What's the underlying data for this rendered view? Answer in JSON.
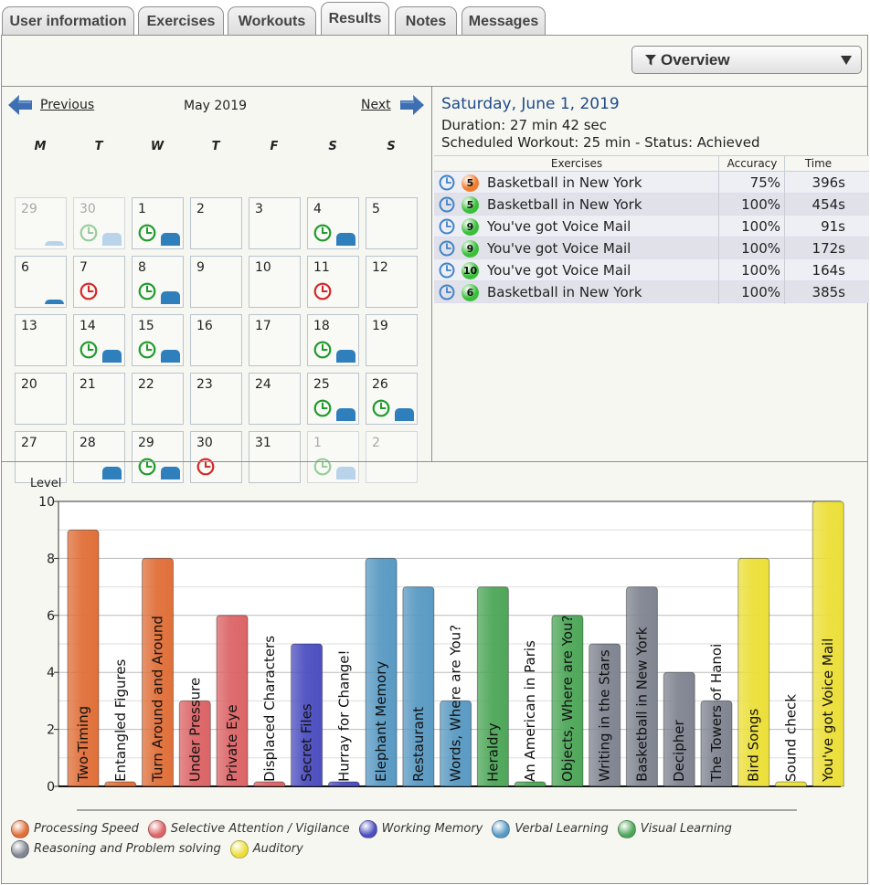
{
  "tabs": [
    {
      "label": "User information",
      "active": false
    },
    {
      "label": "Exercises",
      "active": false
    },
    {
      "label": "Workouts",
      "active": false
    },
    {
      "label": "Results",
      "active": true
    },
    {
      "label": "Notes",
      "active": false
    },
    {
      "label": "Messages",
      "active": false
    }
  ],
  "toolbar": {
    "view_select": "Overview",
    "icons": [
      "filter-icon",
      "triangle-down-icon"
    ]
  },
  "calendar": {
    "prev_label": "Previous",
    "next_label": "Next",
    "month_label": "May 2019",
    "weekdays": [
      "M",
      "T",
      "W",
      "T",
      "F",
      "S",
      "S"
    ],
    "days": [
      {
        "n": "29",
        "other": true,
        "clock": null,
        "bar": "small"
      },
      {
        "n": "30",
        "other": true,
        "clock": "green",
        "bar": "full"
      },
      {
        "n": "1",
        "other": false,
        "clock": "green",
        "bar": "full"
      },
      {
        "n": "2",
        "other": false,
        "clock": null,
        "bar": null
      },
      {
        "n": "3",
        "other": false,
        "clock": null,
        "bar": null
      },
      {
        "n": "4",
        "other": false,
        "clock": "green",
        "bar": "full"
      },
      {
        "n": "5",
        "other": false,
        "clock": null,
        "bar": null
      },
      {
        "n": "6",
        "other": false,
        "clock": null,
        "bar": "small"
      },
      {
        "n": "7",
        "other": false,
        "clock": "red",
        "bar": null
      },
      {
        "n": "8",
        "other": false,
        "clock": "green",
        "bar": "full"
      },
      {
        "n": "9",
        "other": false,
        "clock": null,
        "bar": null
      },
      {
        "n": "10",
        "other": false,
        "clock": null,
        "bar": null
      },
      {
        "n": "11",
        "other": false,
        "clock": "red",
        "bar": null
      },
      {
        "n": "12",
        "other": false,
        "clock": null,
        "bar": null
      },
      {
        "n": "13",
        "other": false,
        "clock": null,
        "bar": null
      },
      {
        "n": "14",
        "other": false,
        "clock": "green",
        "bar": "full"
      },
      {
        "n": "15",
        "other": false,
        "clock": "green",
        "bar": "full"
      },
      {
        "n": "16",
        "other": false,
        "clock": null,
        "bar": null
      },
      {
        "n": "17",
        "other": false,
        "clock": null,
        "bar": null
      },
      {
        "n": "18",
        "other": false,
        "clock": "green",
        "bar": "full"
      },
      {
        "n": "19",
        "other": false,
        "clock": null,
        "bar": null
      },
      {
        "n": "20",
        "other": false,
        "clock": null,
        "bar": null
      },
      {
        "n": "21",
        "other": false,
        "clock": null,
        "bar": null
      },
      {
        "n": "22",
        "other": false,
        "clock": null,
        "bar": null
      },
      {
        "n": "23",
        "other": false,
        "clock": null,
        "bar": null
      },
      {
        "n": "24",
        "other": false,
        "clock": null,
        "bar": null
      },
      {
        "n": "25",
        "other": false,
        "clock": "green",
        "bar": "full"
      },
      {
        "n": "26",
        "other": false,
        "clock": "green",
        "bar": "full"
      },
      {
        "n": "27",
        "other": false,
        "clock": null,
        "bar": null
      },
      {
        "n": "28",
        "other": false,
        "clock": null,
        "bar": "full"
      },
      {
        "n": "29",
        "other": false,
        "clock": "green",
        "bar": "full"
      },
      {
        "n": "30",
        "other": false,
        "clock": "red",
        "bar": null
      },
      {
        "n": "31",
        "other": false,
        "clock": null,
        "bar": null
      },
      {
        "n": "1",
        "other": true,
        "clock": "green",
        "bar": "full"
      },
      {
        "n": "2",
        "other": true,
        "clock": null,
        "bar": null
      }
    ]
  },
  "details": {
    "date": "Saturday, June 1, 2019",
    "duration": "Duration: 27 min 42 sec",
    "scheduled": "Scheduled Workout: 25 min - Status: Achieved",
    "columns": [
      "Exercises",
      "Accuracy",
      "Time"
    ],
    "rows": [
      {
        "level": "5",
        "level_color": "#f07d2e",
        "name": "Basketball in New York",
        "accuracy": "75%",
        "time": "396s"
      },
      {
        "level": "5",
        "level_color": "#3bbf3b",
        "name": "Basketball in New York",
        "accuracy": "100%",
        "time": "454s"
      },
      {
        "level": "9",
        "level_color": "#3bbf3b",
        "name": "You've got Voice Mail",
        "accuracy": "100%",
        "time": "91s"
      },
      {
        "level": "9",
        "level_color": "#3bbf3b",
        "name": "You've got Voice Mail",
        "accuracy": "100%",
        "time": "172s"
      },
      {
        "level": "10",
        "level_color": "#3bbf3b",
        "name": "You've got Voice Mail",
        "accuracy": "100%",
        "time": "164s"
      },
      {
        "level": "6",
        "level_color": "#3bbf3b",
        "name": "Basketball in New York",
        "accuracy": "100%",
        "time": "385s"
      }
    ]
  },
  "colors": {
    "processing_speed": "#e0703a",
    "selective_attention": "#dc6567",
    "working_memory": "#4d4fc0",
    "verbal_learning": "#5a9ac3",
    "visual_learning": "#4fa75a",
    "reasoning": "#808591",
    "auditory": "#ecdf3a",
    "clock_green": "#1f9a2c",
    "clock_red": "#d62626",
    "header_blue": "#1d4a8a"
  },
  "chart_data": {
    "type": "bar",
    "ylabel": "Level",
    "ylim": [
      0,
      10
    ],
    "yticks": [
      0,
      2,
      4,
      6,
      8,
      10
    ],
    "grid": true,
    "categories": [
      "Two-Timing",
      "Entangled Figures",
      "Turn Around and Around",
      "Under Pressure",
      "Private Eye",
      "Displaced Characters",
      "Secret Files",
      "Hurray for Change!",
      "Elephant Memory",
      "Restaurant",
      "Words, Where are You?",
      "Heraldry",
      "An American in Paris",
      "Objects, Where are You?",
      "Writing in the Stars",
      "Basketball in New York",
      "Decipher",
      "The Towers of Hanoi",
      "Bird Songs",
      "Sound check",
      "You've got Voice Mail"
    ],
    "values": [
      9,
      0,
      8,
      3,
      6,
      0,
      5,
      0,
      8,
      7,
      3,
      7,
      0,
      6,
      5,
      7,
      4,
      3,
      8,
      0,
      10
    ],
    "groups": [
      "processing_speed",
      "processing_speed",
      "processing_speed",
      "selective_attention",
      "selective_attention",
      "selective_attention",
      "working_memory",
      "working_memory",
      "verbal_learning",
      "verbal_learning",
      "verbal_learning",
      "visual_learning",
      "visual_learning",
      "visual_learning",
      "reasoning",
      "reasoning",
      "reasoning",
      "reasoning",
      "auditory",
      "auditory",
      "auditory"
    ],
    "legend": [
      {
        "key": "processing_speed",
        "label": "Processing Speed"
      },
      {
        "key": "selective_attention",
        "label": "Selective Attention / Vigilance"
      },
      {
        "key": "working_memory",
        "label": "Working Memory"
      },
      {
        "key": "verbal_learning",
        "label": "Verbal Learning"
      },
      {
        "key": "visual_learning",
        "label": "Visual Learning"
      },
      {
        "key": "reasoning",
        "label": "Reasoning and Problem solving"
      },
      {
        "key": "auditory",
        "label": "Auditory"
      }
    ]
  }
}
